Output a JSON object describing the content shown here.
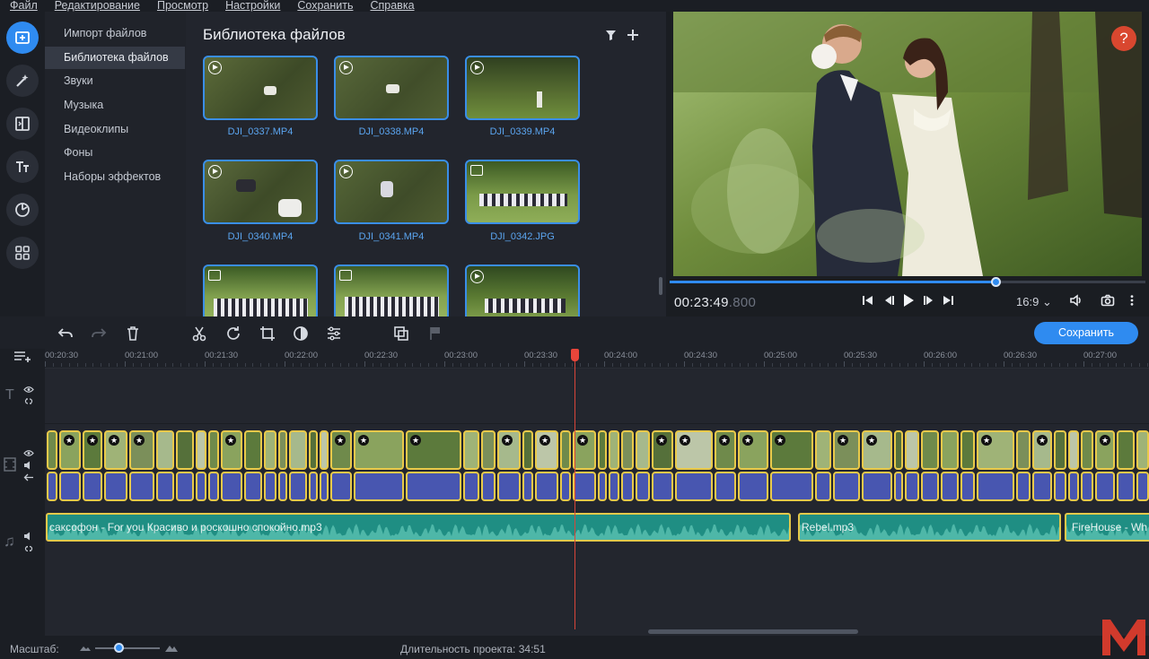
{
  "menu": [
    "Файл",
    "Редактирование",
    "Просмотр",
    "Настройки",
    "Сохранить",
    "Справка"
  ],
  "rail": [
    "import-files-icon",
    "magic-wand-icon",
    "transitions-icon",
    "titles-icon",
    "stickers-icon",
    "more-tools-icon"
  ],
  "categories": [
    {
      "label": "Импорт файлов",
      "selected": false
    },
    {
      "label": "Библиотека файлов",
      "selected": true
    },
    {
      "label": "Звуки",
      "selected": false
    },
    {
      "label": "Музыка",
      "selected": false
    },
    {
      "label": "Видеоклипы",
      "selected": false
    },
    {
      "label": "Фоны",
      "selected": false
    },
    {
      "label": "Наборы эффектов",
      "selected": false
    }
  ],
  "library": {
    "title": "Библиотека файлов",
    "items": [
      {
        "name": "DJI_0337.MP4",
        "kind": "video"
      },
      {
        "name": "DJI_0338.MP4",
        "kind": "video"
      },
      {
        "name": "DJI_0339.MP4",
        "kind": "video"
      },
      {
        "name": "DJI_0340.MP4",
        "kind": "video"
      },
      {
        "name": "DJI_0341.MP4",
        "kind": "video"
      },
      {
        "name": "DJI_0342.JPG",
        "kind": "image"
      },
      {
        "name": "",
        "kind": "image"
      },
      {
        "name": "",
        "kind": "image"
      },
      {
        "name": "",
        "kind": "video"
      }
    ]
  },
  "preview": {
    "timecode_main": "00:23:49",
    "timecode_ms": ".800",
    "aspect": "16:9",
    "progress": 0.685,
    "help": "?"
  },
  "timeline": {
    "save_label": "Сохранить",
    "ruler": [
      "00:20:30",
      "00:21:00",
      "00:21:30",
      "00:22:00",
      "00:22:30",
      "00:23:00",
      "00:23:30",
      "00:24:00",
      "00:24:30",
      "00:25:00",
      "00:25:30",
      "00:26:00",
      "00:26:30",
      "00:27:00"
    ],
    "music": [
      {
        "title": "саксофон - For you Красиво и роскошно спокойно.mp3"
      },
      {
        "title": "Rebel.mp3"
      },
      {
        "title": "FireHouse - Wh"
      }
    ]
  },
  "status": {
    "zoom_label": "Масштаб:",
    "duration_label": "Длительность проекта:",
    "duration_value": "34:51",
    "zoom_level": 0.36
  },
  "colors": {
    "accent": "#2f8bf0",
    "clip_border": "#e8c94a",
    "audio_clip": "#4856b0",
    "music_clip": "#1f8e83",
    "playhead": "#d8453a"
  }
}
